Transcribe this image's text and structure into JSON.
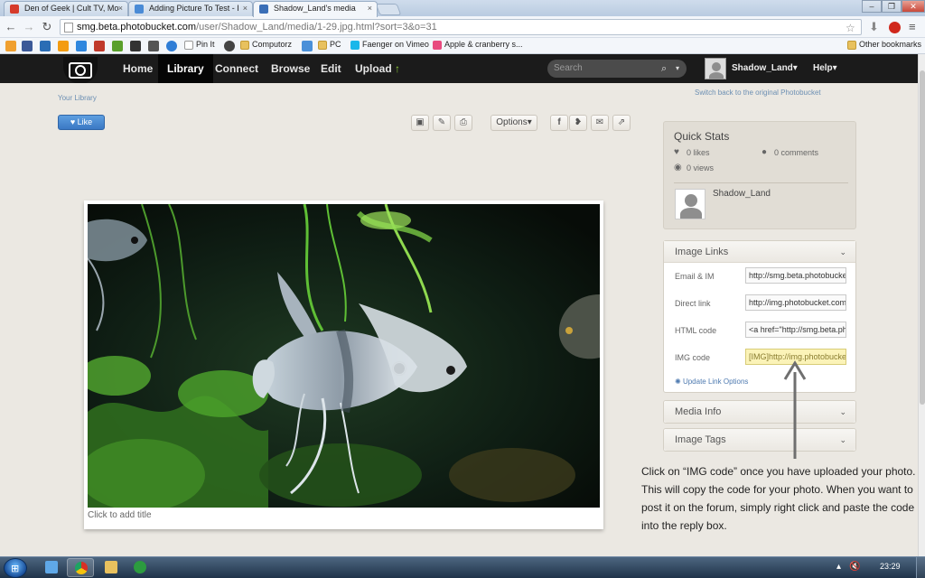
{
  "browser": {
    "tabs": [
      {
        "title": "Den of Geek | Cult TV, Mo",
        "icon_color": "#d63b2b"
      },
      {
        "title": "Adding Picture To Test - I",
        "icon_color": "#4a8bd6"
      },
      {
        "title": "Shadow_Land's media",
        "icon_color": "#3b6fb7",
        "active": true
      }
    ],
    "close_glyph": "×",
    "url_host": "smg.beta.photobucket.com",
    "url_path": "/user/Shadow_Land/media/1-29.jpg.html?sort=3&o=31",
    "bookmarks": [
      {
        "label": "",
        "color": "#f0a030"
      },
      {
        "label": "",
        "color": "#3b5998"
      },
      {
        "label": "",
        "color": "#2a6db5"
      },
      {
        "label": "",
        "color": "#f39c12"
      },
      {
        "label": "",
        "color": "#2e86de"
      },
      {
        "label": "",
        "color": "#c0392b"
      },
      {
        "label": "",
        "color": "#5aa02c"
      },
      {
        "label": "",
        "color": "#333333"
      },
      {
        "label": "",
        "color": "#555555"
      },
      {
        "label": "",
        "color": "#2f7dd6"
      },
      {
        "label": "",
        "color": "#777777"
      },
      {
        "label": "Pin It",
        "color": "#ffffff"
      },
      {
        "label": "",
        "color": "#444444"
      },
      {
        "label": "Computorz",
        "folder": true
      },
      {
        "label": "",
        "color": "#4a90d9"
      },
      {
        "label": "PC",
        "folder": true
      },
      {
        "label": "Faenger on Vimeo",
        "color": "#1ab7ea"
      },
      {
        "label": "Apple & cranberry s...",
        "color": "#e84a7f"
      }
    ],
    "other_bookmarks": "Other bookmarks"
  },
  "site_nav": {
    "items": [
      "Home",
      "Library",
      "Connect",
      "Browse",
      "Edit",
      "Upload"
    ],
    "upload_arrow": "↑",
    "search_placeholder": "Search",
    "user": "Shadow_Land",
    "help": "Help",
    "caret": "▾"
  },
  "page": {
    "your_library": "Your Library",
    "switch_back": "Switch back to the original Photobucket",
    "like": "Like",
    "options": "Options",
    "photo_title_placeholder": "Click to add title"
  },
  "quick_stats": {
    "title": "Quick Stats",
    "likes": "0 likes",
    "comments": "0 comments",
    "views": "0 views",
    "user": "Shadow_Land"
  },
  "image_links": {
    "title": "Image Links",
    "rows": [
      {
        "label": "Email & IM",
        "value": "http://smg.beta.photobucket.com"
      },
      {
        "label": "Direct link",
        "value": "http://img.photobucket.com/albums"
      },
      {
        "label": "HTML code",
        "value": "<a href=\"http://smg.beta.photobucket"
      },
      {
        "label": "IMG code",
        "value": "[IMG]http://img.photobucket.com"
      }
    ],
    "update_options": "Update Link Options"
  },
  "media_info": {
    "title": "Media Info"
  },
  "image_tags": {
    "title": "Image Tags"
  },
  "annotation": {
    "text": "Click on “IMG code” once you have uploaded your photo. This will copy the code for your photo. When you want to post it on the forum, simply right click and paste the code into the reply box."
  },
  "taskbar": {
    "clock": "23:29"
  }
}
